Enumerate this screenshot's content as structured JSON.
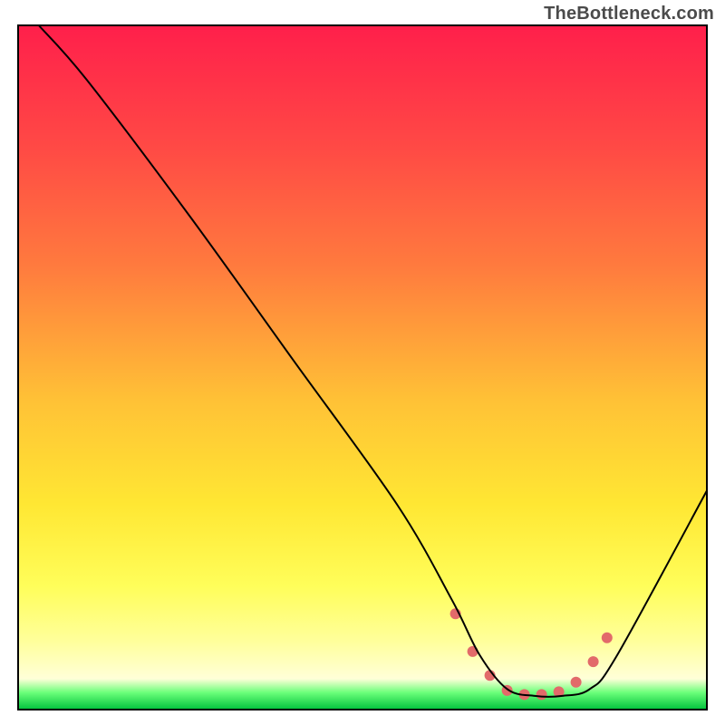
{
  "attribution": "TheBottleneck.com",
  "chart_data": {
    "type": "line",
    "title": "",
    "xlabel": "",
    "ylabel": "",
    "xlim": [
      0,
      100
    ],
    "ylim": [
      0,
      100
    ],
    "grid": false,
    "legend": false,
    "background_gradient_stops": [
      {
        "offset": 0.0,
        "color": "#ff1f4b"
      },
      {
        "offset": 0.18,
        "color": "#ff4a45"
      },
      {
        "offset": 0.35,
        "color": "#ff7a3e"
      },
      {
        "offset": 0.55,
        "color": "#ffc236"
      },
      {
        "offset": 0.7,
        "color": "#ffe733"
      },
      {
        "offset": 0.82,
        "color": "#fffe5a"
      },
      {
        "offset": 0.9,
        "color": "#ffff9b"
      },
      {
        "offset": 0.955,
        "color": "#ffffd8"
      },
      {
        "offset": 0.975,
        "color": "#6bff7a"
      },
      {
        "offset": 1.0,
        "color": "#00c23c"
      }
    ],
    "series": [
      {
        "name": "bottleneck-curve",
        "x": [
          3,
          10,
          25,
          40,
          55,
          63,
          67,
          71,
          75,
          79,
          83,
          87,
          100
        ],
        "y": [
          100,
          92,
          72,
          51,
          30,
          16,
          8,
          3,
          2,
          2,
          3,
          8,
          32
        ],
        "stroke": "#000000",
        "stroke_width": 2
      }
    ],
    "highlight": {
      "name": "optimal-range-dots",
      "x": [
        63.5,
        66,
        68.5,
        71,
        73.5,
        76,
        78.5,
        81,
        83.5,
        85.5
      ],
      "y": [
        14,
        8.5,
        5,
        2.8,
        2.2,
        2.2,
        2.6,
        4,
        7,
        10.5
      ],
      "color": "#e26a6a",
      "radius": 6
    }
  }
}
